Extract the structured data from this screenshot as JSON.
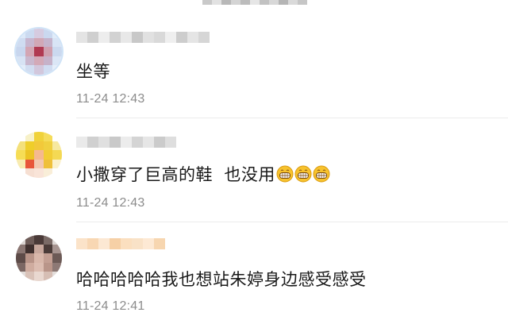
{
  "comments": [
    {
      "text": "坐等",
      "time": "11-24 12:43",
      "emoji_count": 0
    },
    {
      "text": "小撒穿了巨高的鞋  也没用",
      "time": "11-24 12:43",
      "emoji_count": 3,
      "emoji": "grinning-face-icon"
    },
    {
      "text": "哈哈哈哈哈我也想站朱婷身边感受感受",
      "time": "11-24 12:41",
      "emoji_count": 0
    }
  ],
  "colors": {
    "text": "#1a1a1a",
    "time": "#8c8c8c",
    "divider": "#ececec"
  }
}
